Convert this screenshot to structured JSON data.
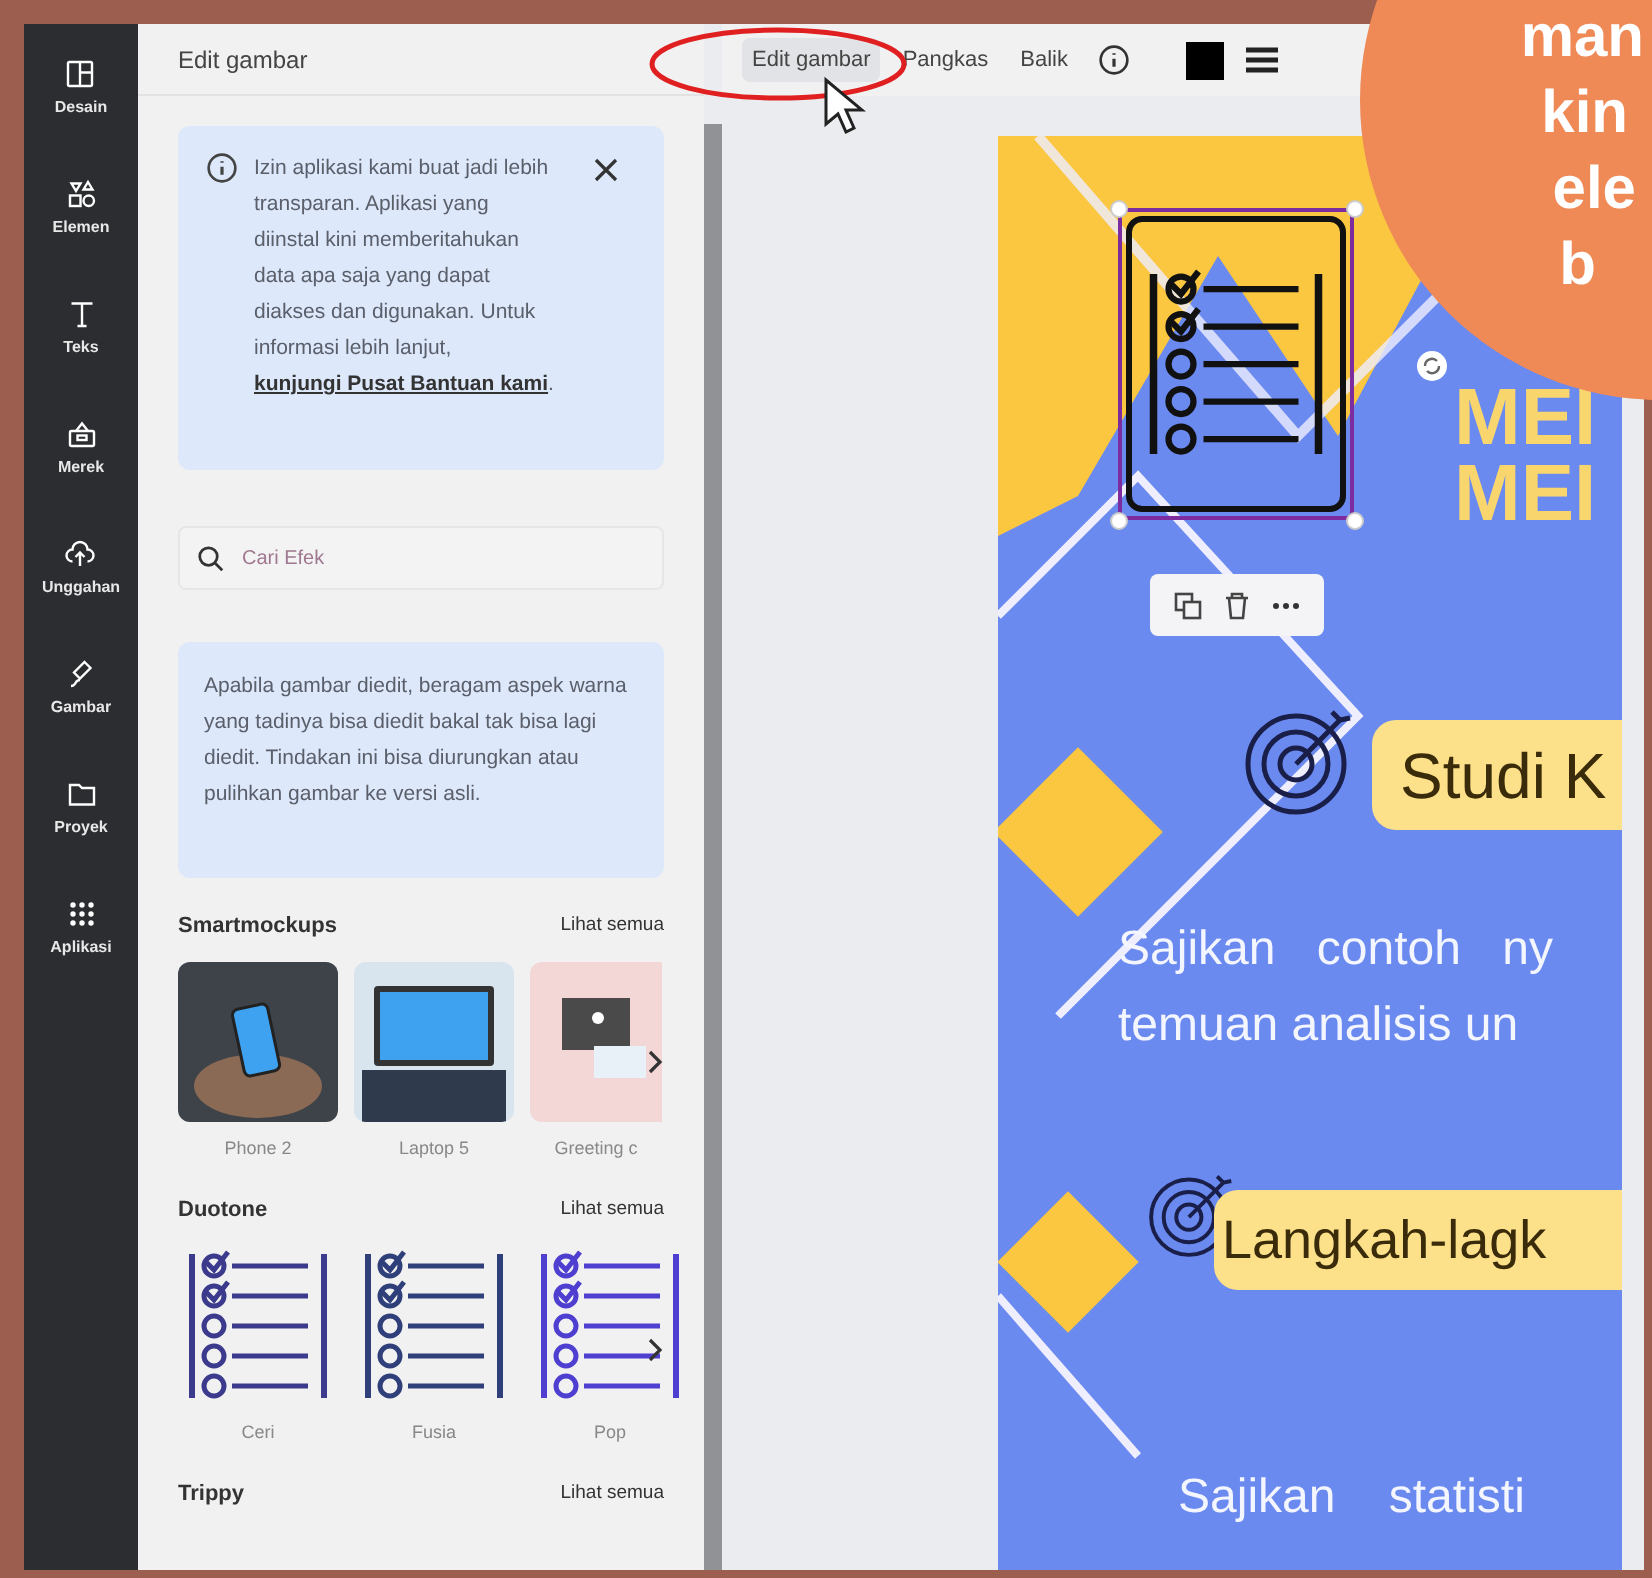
{
  "rail": [
    {
      "label": "Desain"
    },
    {
      "label": "Elemen"
    },
    {
      "label": "Teks"
    },
    {
      "label": "Merek"
    },
    {
      "label": "Unggahan"
    },
    {
      "label": "Gambar"
    },
    {
      "label": "Proyek"
    },
    {
      "label": "Aplikasi"
    }
  ],
  "panel": {
    "title": "Edit gambar",
    "notice": {
      "text": "Izin aplikasi kami buat jadi lebih transparan. Aplikasi yang diinstal kini memberitahukan data apa saja yang dapat diakses dan digunakan. Untuk informasi lebih lanjut, ",
      "link": "kunjungi Pusat Bantuan kami",
      "end": "."
    },
    "search": {
      "placeholder": "Cari Efek"
    },
    "info": "Apabila gambar diedit, beragam aspek warna yang tadinya bisa diedit bakal tak bisa lagi diedit. Tindakan ini bisa diurungkan atau pulihkan gambar ke versi asli.",
    "sections": [
      {
        "title": "Smartmockups",
        "see_all": "Lihat semua",
        "kind": "photo",
        "items": [
          {
            "label": "Phone 2"
          },
          {
            "label": "Laptop 5"
          },
          {
            "label": "Greeting c"
          }
        ]
      },
      {
        "title": "Duotone",
        "see_all": "Lihat semua",
        "kind": "checklist",
        "items": [
          {
            "label": "Ceri",
            "color": "#3b3a8c"
          },
          {
            "label": "Fusia",
            "color": "#2f3f7a"
          },
          {
            "label": "Pop",
            "color": "#4f3fd0"
          }
        ]
      },
      {
        "title": "Trippy",
        "see_all": "Lihat semua"
      }
    ]
  },
  "toolbar": {
    "items": [
      {
        "label": "Edit gambar",
        "selected": true
      },
      {
        "label": "Pangkas",
        "selected": false
      },
      {
        "label": "Balik",
        "selected": false
      }
    ]
  },
  "poster": {
    "heading": [
      "MEI",
      "MEI"
    ],
    "items": [
      {
        "title": "Studi K",
        "body": [
          "Sajikan contoh ny",
          "temuan analisis un"
        ]
      },
      {
        "title": "Langkah-lagk",
        "body": [
          "Sajikan statisti"
        ]
      }
    ]
  },
  "overlay": {
    "lines": [
      "man",
      "kin",
      "ele",
      "b"
    ]
  }
}
